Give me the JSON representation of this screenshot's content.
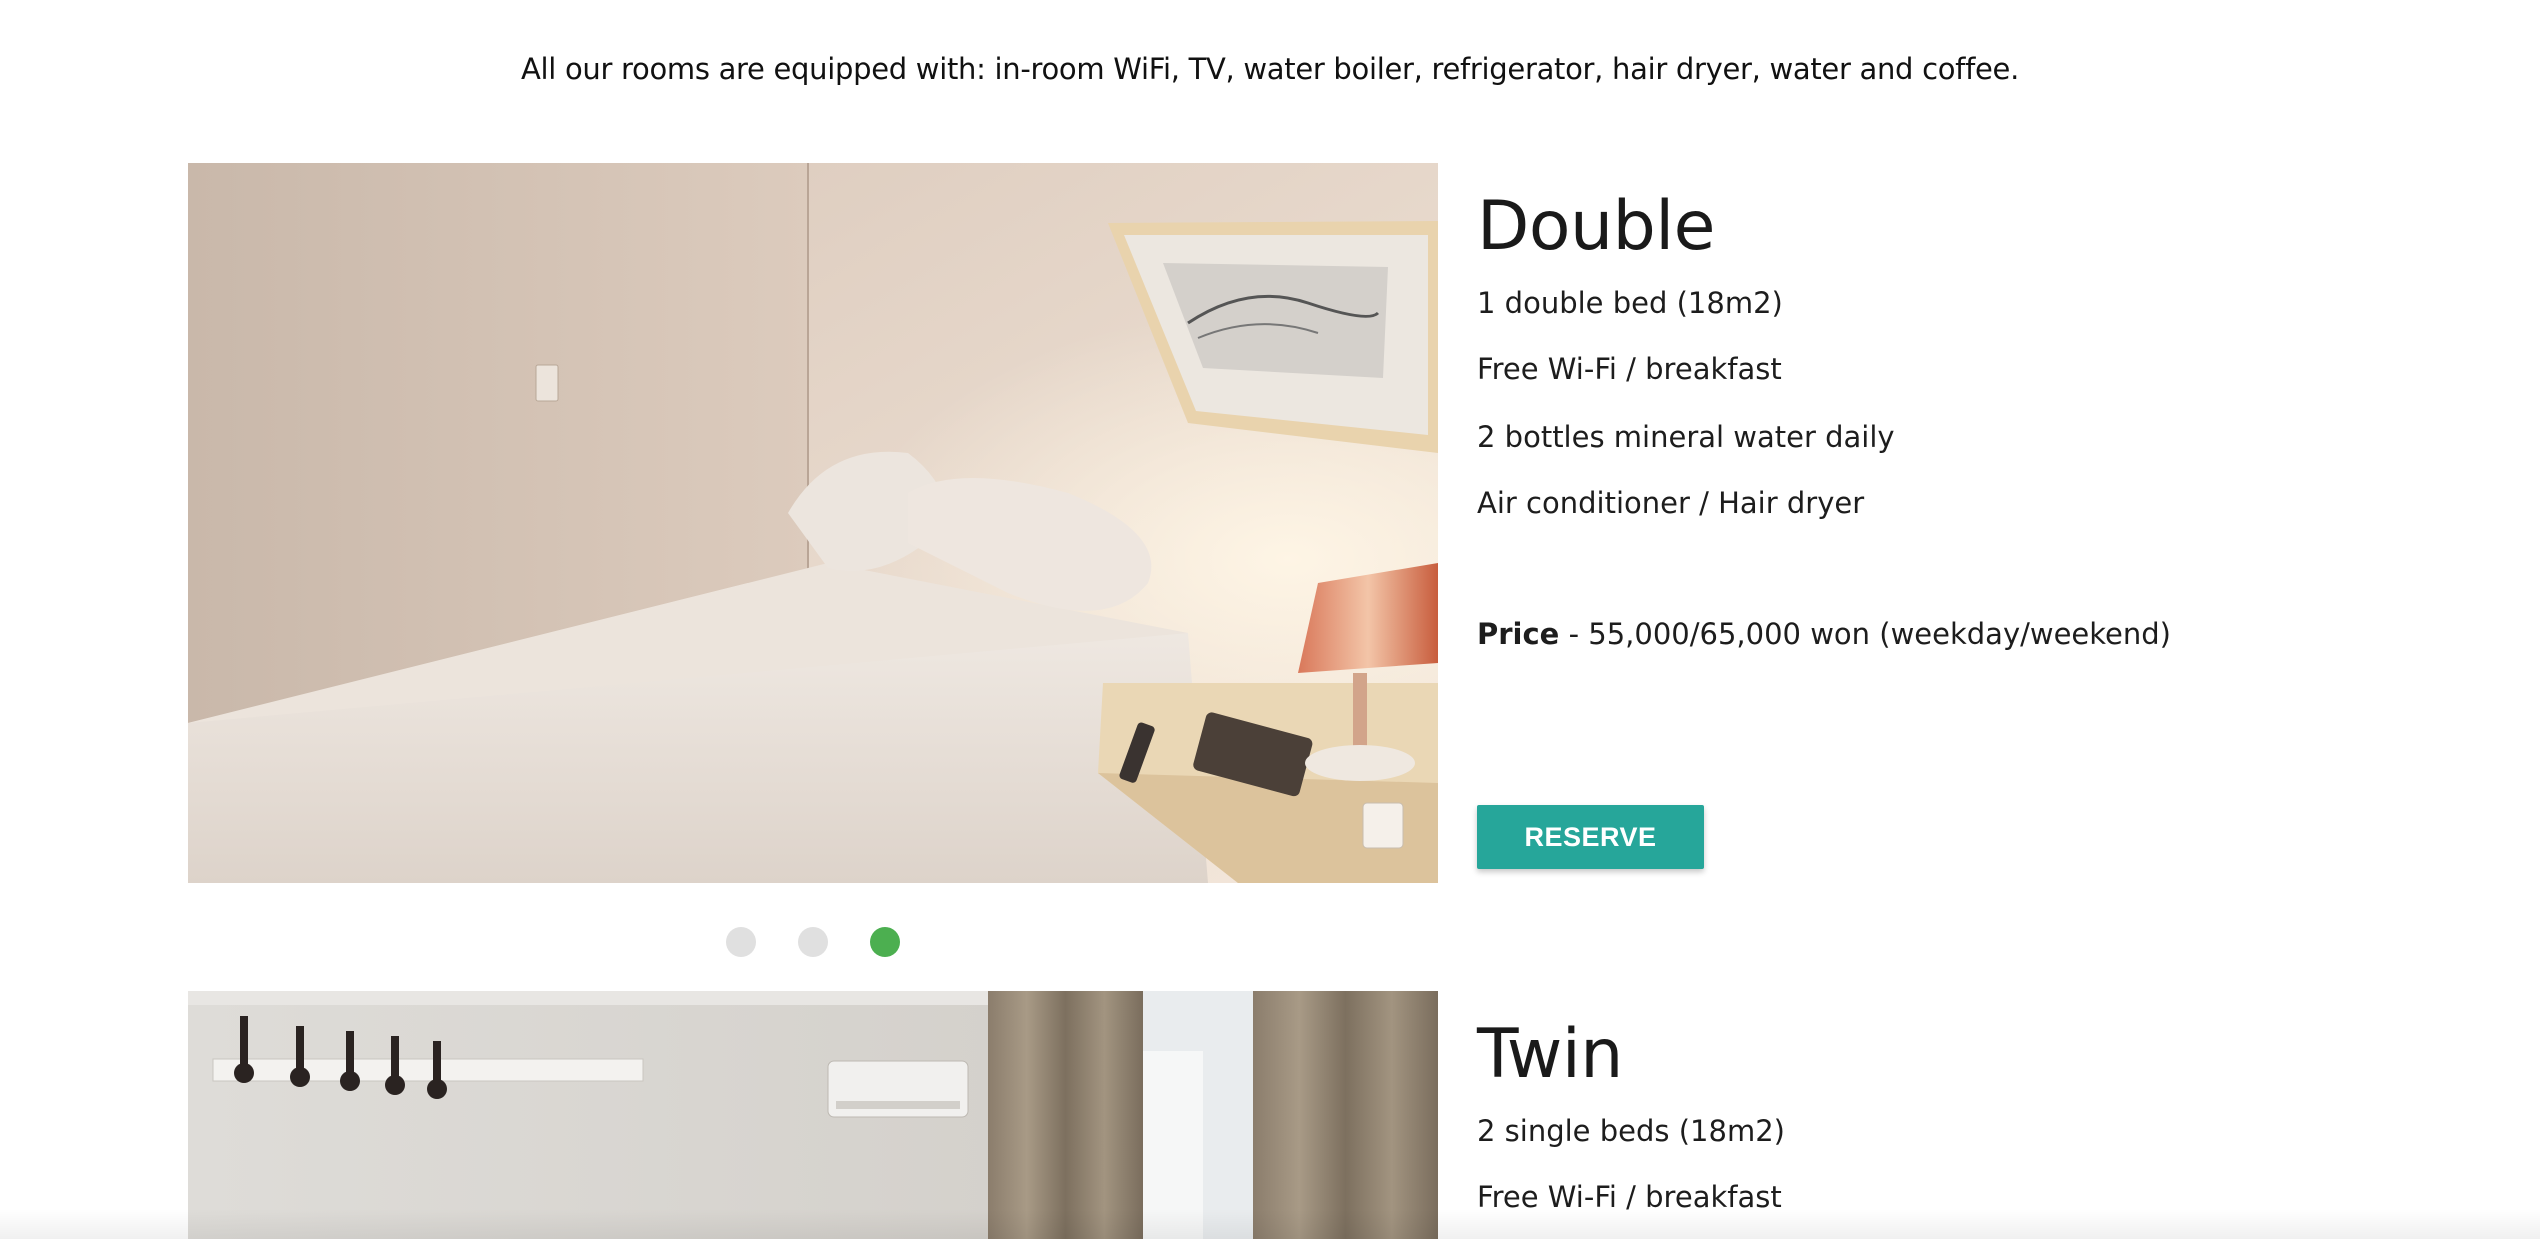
{
  "intro": "All our rooms are equipped with: in-room WiFi, TV, water boiler, refrigerator, hair dryer, water and coffee.",
  "rooms": [
    {
      "title": "Double",
      "features": [
        "1 double bed (18m2)",
        "Free Wi-Fi / breakfast",
        "2 bottles mineral water daily",
        "Air conditioner / Hair dryer"
      ],
      "price_label": "Price",
      "price_value": " - 55,000/65,000 won (weekday/weekend)",
      "reserve_label": "RESERVE",
      "carousel": {
        "count": 3,
        "active_index": 3
      }
    },
    {
      "title": "Twin",
      "features": [
        "2 single beds (18m2)",
        "Free Wi-Fi / breakfast"
      ]
    }
  ],
  "colors": {
    "reserve_button": "#26a69a",
    "dot_active": "#4caf50",
    "dot_inactive": "#e0e0e0"
  }
}
